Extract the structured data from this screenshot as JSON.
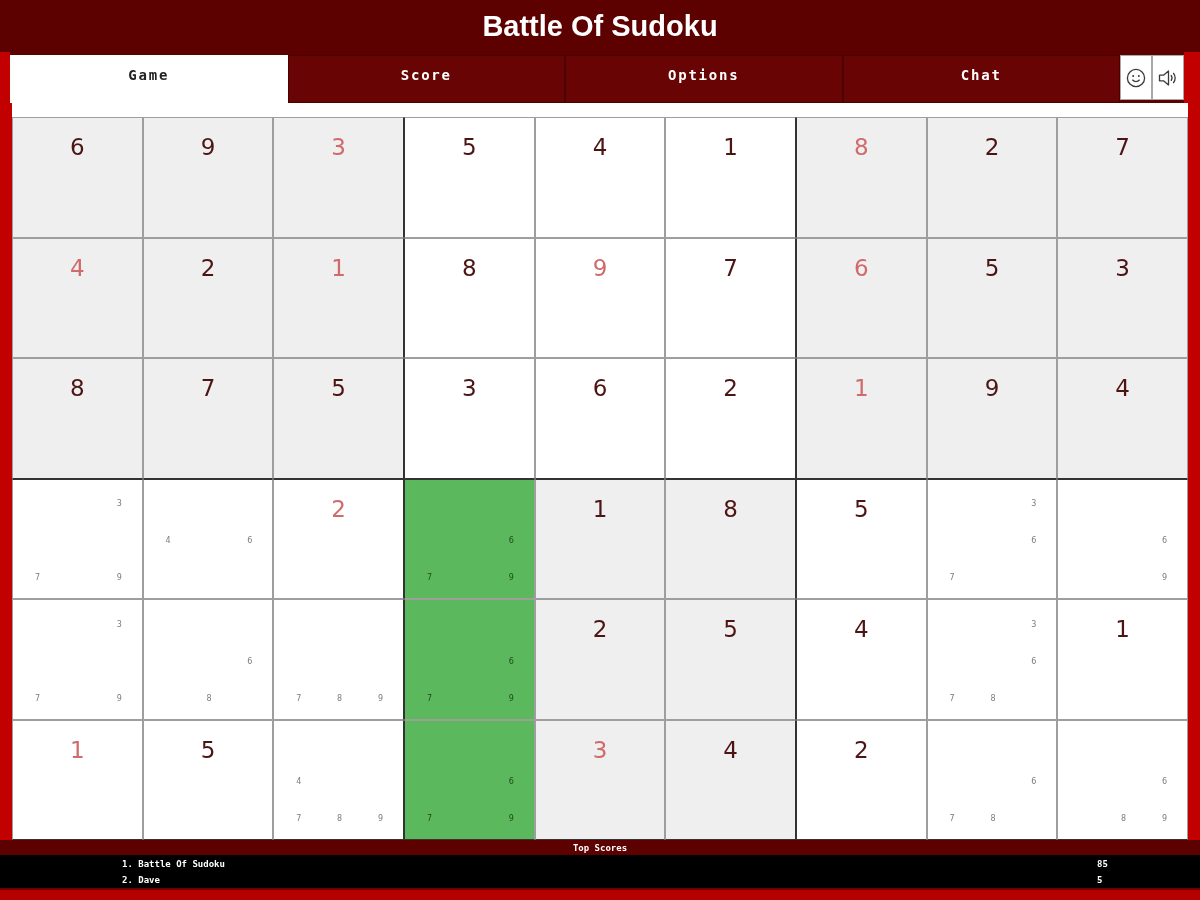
{
  "header": {
    "title": "Battle Of Sudoku"
  },
  "tabs": [
    {
      "label": "Game",
      "selected": true
    },
    {
      "label": "Score",
      "selected": false
    },
    {
      "label": "Options",
      "selected": false
    },
    {
      "label": "Chat",
      "selected": false
    }
  ],
  "board": {
    "rows": [
      [
        {
          "kind": "given",
          "value": "6",
          "highlighted": false
        },
        {
          "kind": "given",
          "value": "9",
          "highlighted": false
        },
        {
          "kind": "entered",
          "value": "3",
          "highlighted": false
        },
        {
          "kind": "given",
          "value": "5",
          "highlighted": false
        },
        {
          "kind": "given",
          "value": "4",
          "highlighted": false
        },
        {
          "kind": "given",
          "value": "1",
          "highlighted": false
        },
        {
          "kind": "entered",
          "value": "8",
          "highlighted": false
        },
        {
          "kind": "given",
          "value": "2",
          "highlighted": false
        },
        {
          "kind": "given",
          "value": "7",
          "highlighted": false
        }
      ],
      [
        {
          "kind": "entered",
          "value": "4",
          "highlighted": false
        },
        {
          "kind": "given",
          "value": "2",
          "highlighted": false
        },
        {
          "kind": "entered",
          "value": "1",
          "highlighted": false
        },
        {
          "kind": "given",
          "value": "8",
          "highlighted": false
        },
        {
          "kind": "entered",
          "value": "9",
          "highlighted": false
        },
        {
          "kind": "given",
          "value": "7",
          "highlighted": false
        },
        {
          "kind": "entered",
          "value": "6",
          "highlighted": false
        },
        {
          "kind": "given",
          "value": "5",
          "highlighted": false
        },
        {
          "kind": "given",
          "value": "3",
          "highlighted": false
        }
      ],
      [
        {
          "kind": "given",
          "value": "8",
          "highlighted": false
        },
        {
          "kind": "given",
          "value": "7",
          "highlighted": false
        },
        {
          "kind": "given",
          "value": "5",
          "highlighted": false
        },
        {
          "kind": "given",
          "value": "3",
          "highlighted": false
        },
        {
          "kind": "given",
          "value": "6",
          "highlighted": false
        },
        {
          "kind": "given",
          "value": "2",
          "highlighted": false
        },
        {
          "kind": "entered",
          "value": "1",
          "highlighted": false
        },
        {
          "kind": "given",
          "value": "9",
          "highlighted": false
        },
        {
          "kind": "given",
          "value": "4",
          "highlighted": false
        }
      ],
      [
        {
          "kind": "notes",
          "notes": [
            "3",
            "7",
            "9"
          ],
          "highlighted": false
        },
        {
          "kind": "notes",
          "notes": [
            "4",
            "6"
          ],
          "highlighted": false
        },
        {
          "kind": "entered",
          "value": "2",
          "highlighted": false
        },
        {
          "kind": "notes",
          "notes": [
            "6",
            "7",
            "9"
          ],
          "highlighted": true
        },
        {
          "kind": "given",
          "value": "1",
          "highlighted": false
        },
        {
          "kind": "given",
          "value": "8",
          "highlighted": false
        },
        {
          "kind": "given",
          "value": "5",
          "highlighted": false
        },
        {
          "kind": "notes",
          "notes": [
            "3",
            "6",
            "7"
          ],
          "highlighted": false
        },
        {
          "kind": "notes",
          "notes": [
            "6",
            "9"
          ],
          "highlighted": false
        }
      ],
      [
        {
          "kind": "notes",
          "notes": [
            "3",
            "7",
            "9"
          ],
          "highlighted": false
        },
        {
          "kind": "notes",
          "notes": [
            "6",
            "8"
          ],
          "highlighted": false
        },
        {
          "kind": "notes",
          "notes": [
            "7",
            "8",
            "9"
          ],
          "highlighted": false
        },
        {
          "kind": "notes",
          "notes": [
            "6",
            "7",
            "9"
          ],
          "highlighted": true
        },
        {
          "kind": "given",
          "value": "2",
          "highlighted": false
        },
        {
          "kind": "given",
          "value": "5",
          "highlighted": false
        },
        {
          "kind": "given",
          "value": "4",
          "highlighted": false
        },
        {
          "kind": "notes",
          "notes": [
            "3",
            "6",
            "7",
            "8"
          ],
          "highlighted": false
        },
        {
          "kind": "given",
          "value": "1",
          "highlighted": false
        }
      ],
      [
        {
          "kind": "entered",
          "value": "1",
          "highlighted": false
        },
        {
          "kind": "given",
          "value": "5",
          "highlighted": false
        },
        {
          "kind": "notes",
          "notes": [
            "4",
            "7",
            "8",
            "9"
          ],
          "highlighted": false
        },
        {
          "kind": "notes",
          "notes": [
            "6",
            "7",
            "9"
          ],
          "highlighted": true
        },
        {
          "kind": "entered",
          "value": "3",
          "highlighted": false
        },
        {
          "kind": "given",
          "value": "4",
          "highlighted": false
        },
        {
          "kind": "given",
          "value": "2",
          "highlighted": false
        },
        {
          "kind": "notes",
          "notes": [
            "6",
            "7",
            "8"
          ],
          "highlighted": false
        },
        {
          "kind": "notes",
          "notes": [
            "6",
            "8",
            "9"
          ],
          "highlighted": false
        }
      ]
    ]
  },
  "scores": {
    "title": "Top Scores",
    "entries": [
      {
        "player": "1. Battle Of Sudoku",
        "score": "85"
      },
      {
        "player": "2. Dave",
        "score": "5"
      }
    ]
  }
}
